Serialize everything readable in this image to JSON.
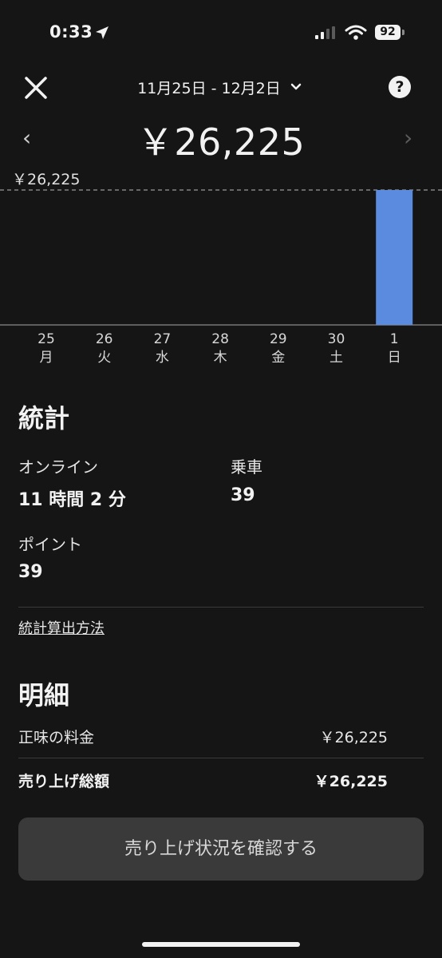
{
  "status_bar": {
    "time": "0:33",
    "battery": "92"
  },
  "header": {
    "date_range": "11月25日 - 12月2日",
    "help": "?",
    "prev": "‹",
    "next": "›",
    "total": "￥26,225"
  },
  "chart_data": {
    "type": "bar",
    "max_label": "￥26,225",
    "categories": [
      {
        "day": "25",
        "weekday": "月"
      },
      {
        "day": "26",
        "weekday": "火"
      },
      {
        "day": "27",
        "weekday": "水"
      },
      {
        "day": "28",
        "weekday": "木"
      },
      {
        "day": "29",
        "weekday": "金"
      },
      {
        "day": "30",
        "weekday": "土"
      },
      {
        "day": "1",
        "weekday": "日"
      }
    ],
    "values": [
      0,
      0,
      0,
      0,
      0,
      0,
      26225
    ],
    "ylim": [
      0,
      26225
    ],
    "bar_color": "#5b8bdf"
  },
  "stats": {
    "title": "統計",
    "online_label": "オンライン",
    "online_value": "11 時間 2 分",
    "rides_label": "乗車",
    "rides_value": "39",
    "points_label": "ポイント",
    "points_value": "39",
    "method_link": "統計算出方法"
  },
  "details": {
    "title": "明細",
    "net_fare_label": "正味の料金",
    "net_fare_value": "￥26,225",
    "total_sales_label": "売り上げ総額",
    "total_sales_value": "￥26,225"
  },
  "cta": {
    "label": "売り上げ状況を確認する"
  }
}
